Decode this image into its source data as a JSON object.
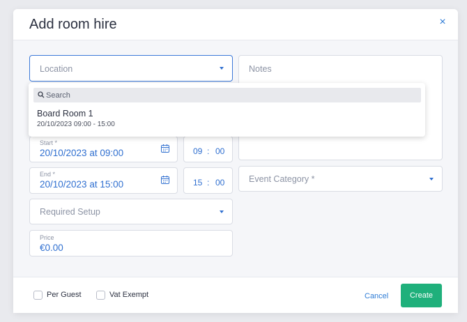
{
  "modal": {
    "title": "Add room hire",
    "close_glyph": "×"
  },
  "form": {
    "location_placeholder": "Location",
    "notes_placeholder": "Notes",
    "start": {
      "label": "Start *",
      "value": "20/10/2023 at 09:00",
      "hour": "09",
      "minute": "00"
    },
    "end": {
      "label": "End *",
      "value": "20/10/2023 at 15:00",
      "hour": "15",
      "minute": "00"
    },
    "event_category_placeholder": "Event Category *",
    "required_setup_placeholder": "Required Setup",
    "price": {
      "label": "Price",
      "value": "€0.00"
    }
  },
  "location_dropdown": {
    "search_placeholder": "Search",
    "options": [
      {
        "title": "Board Room 1",
        "subtitle": "20/10/2023 09:00 - 15:00"
      }
    ]
  },
  "footer": {
    "per_guest_label": "Per Guest",
    "vat_exempt_label": "Vat Exempt",
    "cancel_label": "Cancel",
    "create_label": "Create"
  },
  "colors": {
    "accent": "#2f6fd0",
    "create_button": "#1fb07b"
  },
  "icons": [
    "close-icon",
    "chevron-down-icon",
    "calendar-icon",
    "search-icon"
  ]
}
